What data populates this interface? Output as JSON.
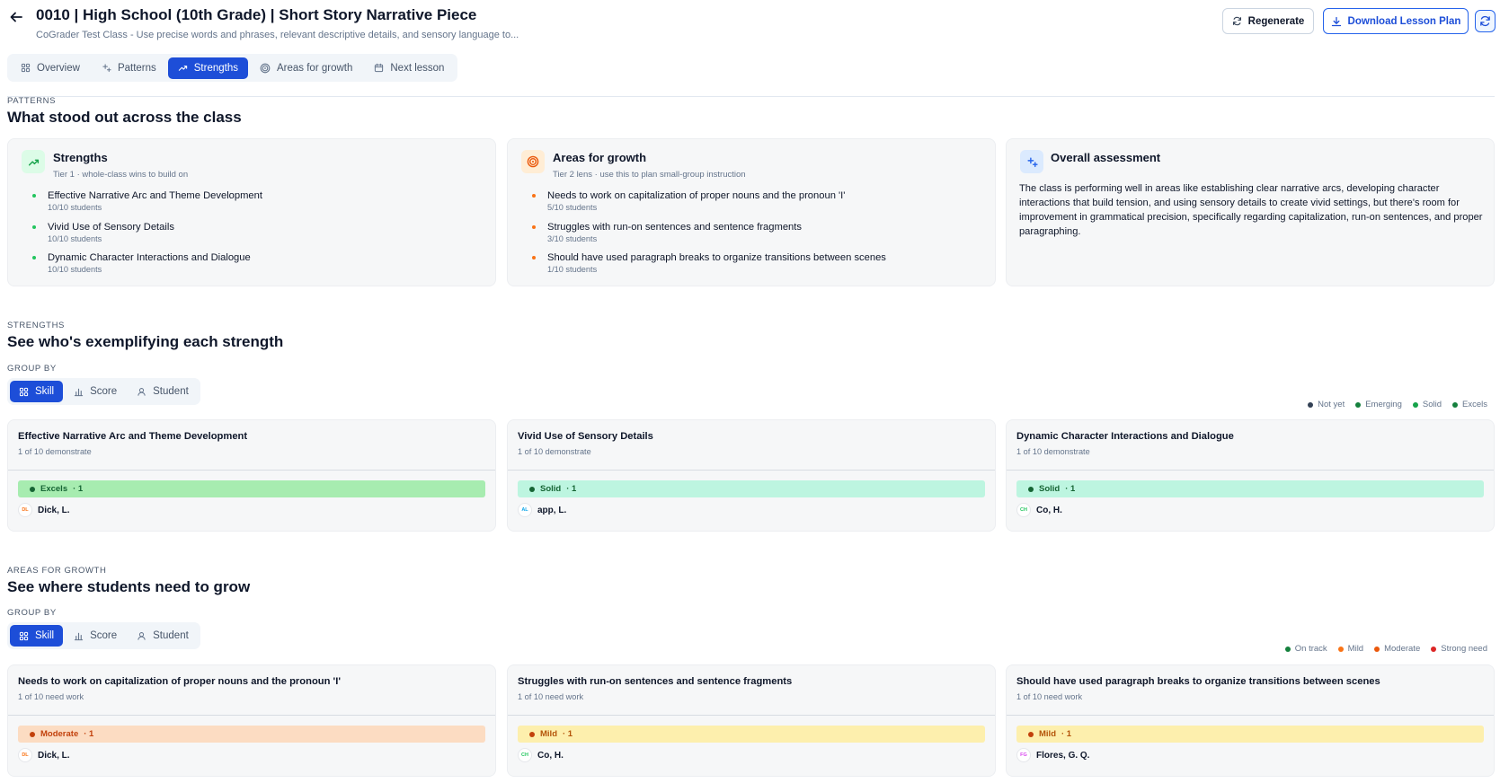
{
  "header": {
    "title": "0010 | High School (10th Grade) | Short Story Narrative Piece",
    "subtitle": "CoGrader Test Class - Use precise words and phrases, relevant descriptive details, and sensory language to...",
    "regenerate_label": "Regenerate",
    "download_label": "Download Lesson Plan"
  },
  "tabs": [
    {
      "label": "Overview",
      "icon": "grid-icon",
      "active": false
    },
    {
      "label": "Patterns",
      "icon": "sparkles-icon",
      "active": false
    },
    {
      "label": "Strengths",
      "icon": "trending-up-icon",
      "active": true
    },
    {
      "label": "Areas for growth",
      "icon": "target-icon",
      "active": false
    },
    {
      "label": "Next lesson",
      "icon": "calendar-icon",
      "active": false
    }
  ],
  "patterns": {
    "eyebrow": "PATTERNS",
    "title": "What stood out across the class",
    "strengths_card": {
      "title": "Strengths",
      "subtitle": "Tier 1 · whole-class wins to build on",
      "accent": "#22c55e",
      "items": [
        {
          "text": "Effective Narrative Arc and Theme Development",
          "count": "10/10 students"
        },
        {
          "text": "Vivid Use of Sensory Details",
          "count": "10/10 students"
        },
        {
          "text": "Dynamic Character Interactions and Dialogue",
          "count": "10/10 students"
        }
      ]
    },
    "growth_card": {
      "title": "Areas for growth",
      "subtitle": "Tier 2 lens · use this to plan small-group instruction",
      "accent": "#f97316",
      "items": [
        {
          "text": "Needs to work on capitalization of proper nouns and the pronoun 'I'",
          "count": "5/10 students"
        },
        {
          "text": "Struggles with run-on sentences and sentence fragments",
          "count": "3/10 students"
        },
        {
          "text": "Should have used paragraph breaks to organize transitions between scenes",
          "count": "1/10 students"
        }
      ]
    },
    "assessment_card": {
      "title": "Overall assessment",
      "text": "The class is performing well in areas like establishing clear narrative arcs, developing character interactions that build tension, and using sensory details to create vivid settings, but there's room for improvement in grammatical precision, specifically regarding capitalization, run-on sentences, and proper paragraphing."
    }
  },
  "strengths_section": {
    "eyebrow": "STRENGTHS",
    "title": "See who's exemplifying each strength",
    "group_by_label": "GROUP BY",
    "group_options": [
      "Skill",
      "Score",
      "Student"
    ],
    "legend": [
      {
        "label": "Not yet",
        "color": "#334155"
      },
      {
        "label": "Emerging",
        "color": "#15803d"
      },
      {
        "label": "Solid",
        "color": "#16a34a"
      },
      {
        "label": "Excels",
        "color": "#15803d"
      }
    ],
    "cards": [
      {
        "title": "Effective Narrative Arc and Theme Development",
        "subtitle": "1 of 10 demonstrate",
        "band_label": "Excels",
        "band_count": "· 1",
        "band_bg": "#a7ecb0",
        "band_dot": "#166534",
        "band_text": "#166534",
        "student_initials": "DL",
        "student_name": "Dick, L.",
        "avatar_color": "#f97316"
      },
      {
        "title": "Vivid Use of Sensory Details",
        "subtitle": "1 of 10 demonstrate",
        "band_label": "Solid",
        "band_count": "· 1",
        "band_bg": "#bdf5e0",
        "band_dot": "#166534",
        "band_text": "#166534",
        "student_initials": "AL",
        "student_name": "app, L.",
        "avatar_color": "#0ea5e9"
      },
      {
        "title": "Dynamic Character Interactions and Dialogue",
        "subtitle": "1 of 10 demonstrate",
        "band_label": "Solid",
        "band_count": "· 1",
        "band_bg": "#bdf5e0",
        "band_dot": "#166534",
        "band_text": "#166534",
        "student_initials": "CH",
        "student_name": "Co, H.",
        "avatar_color": "#22c55e"
      }
    ]
  },
  "growth_section": {
    "eyebrow": "AREAS FOR GROWTH",
    "title": "See where students need to grow",
    "group_by_label": "GROUP BY",
    "group_options": [
      "Skill",
      "Score",
      "Student"
    ],
    "legend": [
      {
        "label": "On track",
        "color": "#15803d"
      },
      {
        "label": "Mild",
        "color": "#f97316"
      },
      {
        "label": "Moderate",
        "color": "#ea580c"
      },
      {
        "label": "Strong need",
        "color": "#dc2626"
      }
    ],
    "cards": [
      {
        "title": "Needs to work on capitalization of proper nouns and the pronoun 'I'",
        "subtitle": "1 of 10 need work",
        "band_label": "Moderate",
        "band_count": "· 1",
        "band_bg": "#fcdcc2",
        "band_dot": "#c2410c",
        "band_text": "#c2410c",
        "student_initials": "DL",
        "student_name": "Dick, L.",
        "avatar_color": "#f97316"
      },
      {
        "title": "Struggles with run-on sentences and sentence fragments",
        "subtitle": "1 of 10 need work",
        "band_label": "Mild",
        "band_count": "· 1",
        "band_bg": "#fdefad",
        "band_dot": "#c2410c",
        "band_text": "#b45309",
        "student_initials": "CH",
        "student_name": "Co, H.",
        "avatar_color": "#22c55e"
      },
      {
        "title": "Should have used paragraph breaks to organize transitions between scenes",
        "subtitle": "1 of 10 need work",
        "band_label": "Mild",
        "band_count": "· 1",
        "band_bg": "#fdefad",
        "band_dot": "#c2410c",
        "band_text": "#b45309",
        "student_initials": "FG",
        "student_name": "Flores, G. Q.",
        "avatar_color": "#d946ef"
      }
    ]
  }
}
